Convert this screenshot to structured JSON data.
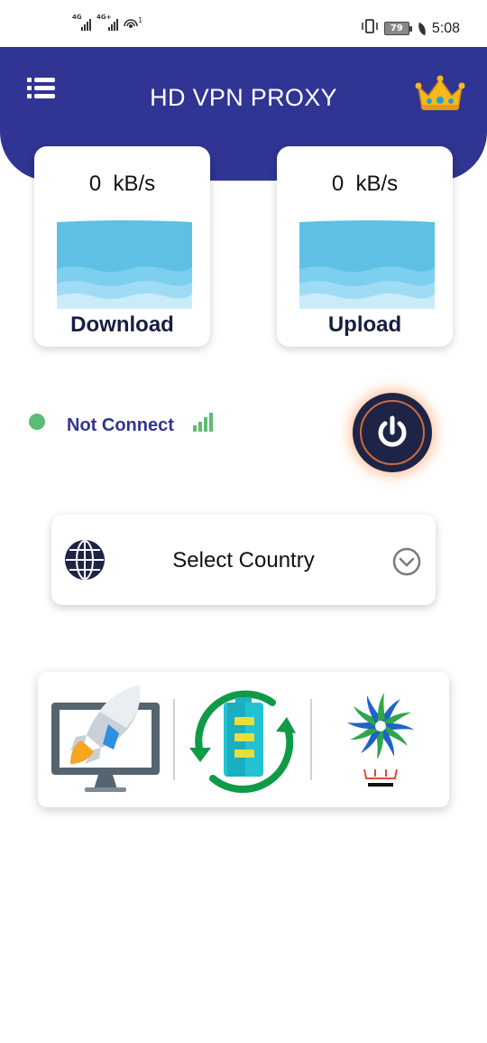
{
  "status_bar": {
    "network_1": "4G",
    "network_2": "4G+",
    "hotspot_badge": "1",
    "battery_level": "79",
    "time": "5:08"
  },
  "header": {
    "title": "HD VPN PROXY",
    "menu_icon": "menu-list-icon",
    "premium_icon": "crown-icon",
    "color": "#303493"
  },
  "speed": {
    "download": {
      "value": "0  kB/s",
      "label": "Download"
    },
    "upload": {
      "value": "0  kB/s",
      "label": "Upload"
    }
  },
  "connection": {
    "status_text": "Not Connect",
    "status_color": "#5cbc74",
    "power_icon": "power-icon"
  },
  "country_selector": {
    "label": "Select Country",
    "left_icon": "globe-icon",
    "right_icon": "chevron-down-circle-icon"
  },
  "tools": [
    {
      "name": "booster",
      "icon": "rocket-monitor-icon"
    },
    {
      "name": "battery-saver",
      "icon": "battery-refresh-icon"
    },
    {
      "name": "cpu-cooler",
      "icon": "cooler-fan-icon"
    }
  ]
}
